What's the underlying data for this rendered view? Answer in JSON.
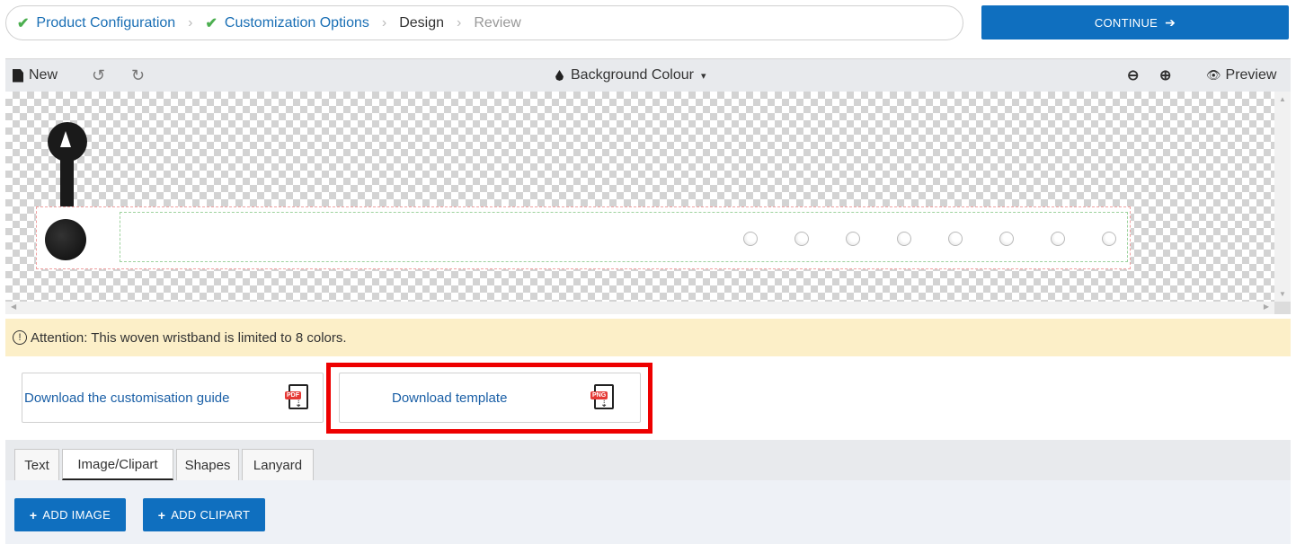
{
  "breadcrumb": {
    "steps": [
      {
        "label": "Product Configuration",
        "state": "done"
      },
      {
        "label": "Customization Options",
        "state": "done"
      },
      {
        "label": "Design",
        "state": "current"
      },
      {
        "label": "Review",
        "state": "future"
      }
    ],
    "separator": "›",
    "check_glyph": "✔"
  },
  "continue_button": {
    "label": "CONTINUE",
    "arrow": "➔"
  },
  "toolbar": {
    "new_label": "New",
    "undo_glyph": "↺",
    "redo_glyph": "↻",
    "background_label": "Background Colour",
    "caret": "▾",
    "zoom_out_glyph": "⊖",
    "zoom_in_glyph": "⊕",
    "preview_label": "Preview",
    "eye_glyph": "👁"
  },
  "attention": {
    "icon": "!",
    "text": "Attention: This woven wristband is limited to 8 colors."
  },
  "downloads": {
    "guide_label": "Download the customisation guide",
    "guide_file_type": "PDF",
    "template_label": "Download template",
    "template_file_type": "PNG",
    "download_glyph": "⇣"
  },
  "tabs": [
    {
      "label": "Text",
      "active": false
    },
    {
      "label": "Image/Clipart",
      "active": true
    },
    {
      "label": "Shapes",
      "active": false
    },
    {
      "label": "Lanyard",
      "active": false
    }
  ],
  "actions": {
    "plus_glyph": "+",
    "add_image_label": "ADD IMAGE",
    "add_clipart_label": "ADD CLIPART"
  },
  "colors": {
    "primary": "#0f6fbf",
    "check": "#4caf50",
    "attention_bg": "#fcefc8",
    "highlight": "#ee0000"
  }
}
